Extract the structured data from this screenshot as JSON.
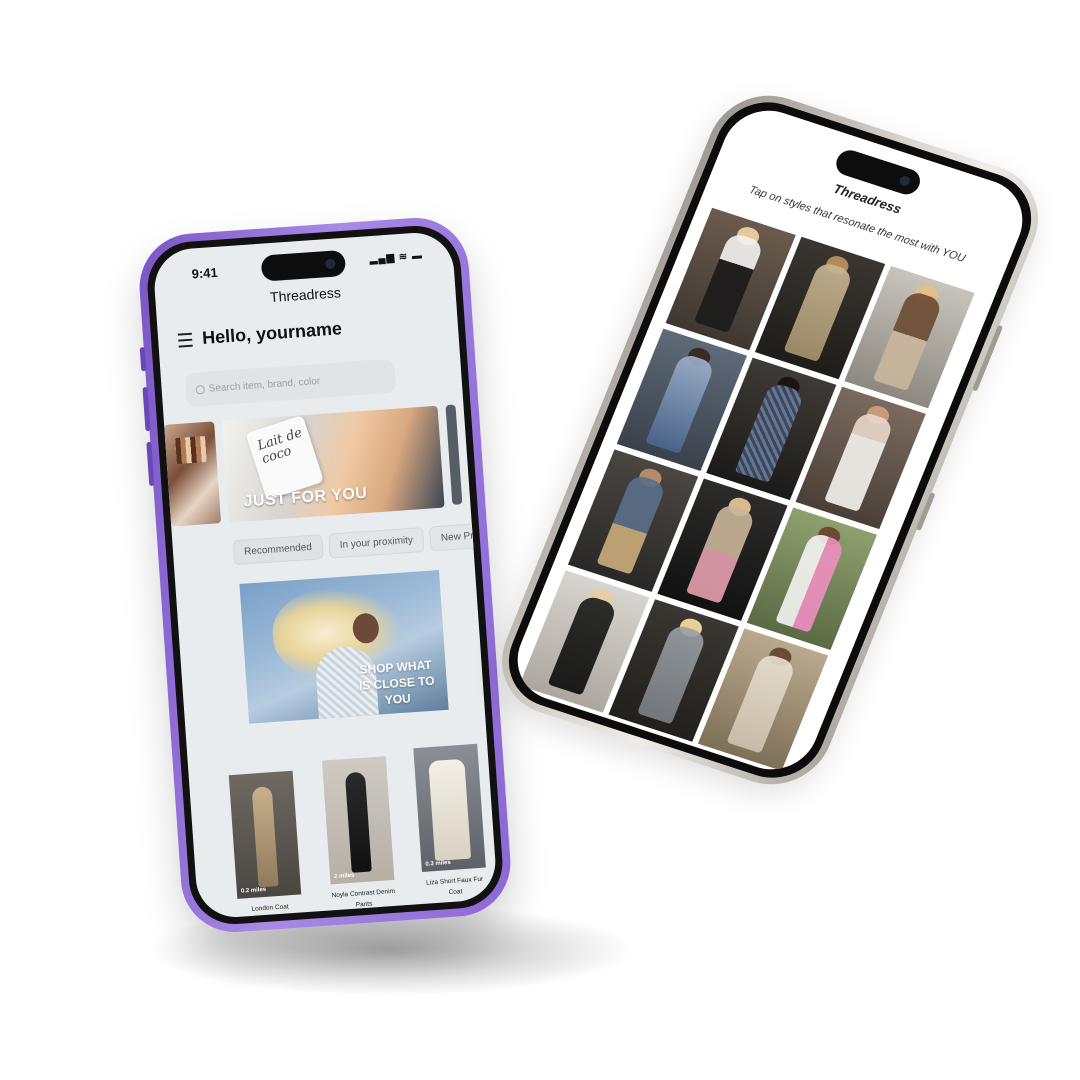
{
  "phone1": {
    "status_time": "9:41",
    "status_icons": "▂▄▆ ≋ ▬",
    "app_title": "Threadress",
    "greeting": "Hello, yourname",
    "search_placeholder": "Search item, brand, color",
    "banner_label": "JUST FOR YOU",
    "banner_can_text": "Lait de coco",
    "chips": [
      "Recommended",
      "In your proximity",
      "New Produc"
    ],
    "promo_text": "SHOP WHAT IS CLOSE TO YOU",
    "products": [
      {
        "name": "London Coat",
        "distance": "0.2 miles"
      },
      {
        "name": "Noyla Contrast Denim Pants",
        "distance": "2 miles"
      },
      {
        "name": "Liza Short Faux Fur Coat",
        "distance": "0.3 miles"
      }
    ]
  },
  "phone2": {
    "app_title": "Threadress",
    "prompt": "Tap on styles that resonate the most with YOU"
  },
  "colors": {
    "phone1_frame": "#8c67d6",
    "phone2_frame": "#d8d4cd",
    "screen_bg": "#e9ecee"
  }
}
